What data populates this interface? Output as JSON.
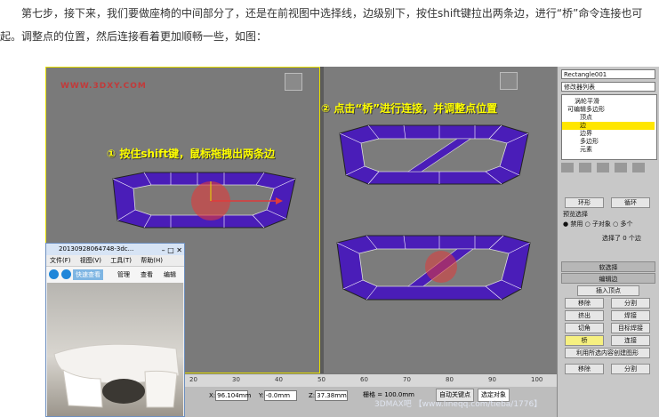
{
  "article": {
    "line1": "第七步，接下来，我们要做座椅的中间部分了，还是在前视图中选择线，边级别下，按住shift键拉出两条边，进行“桥”命令连接也可",
    "line2": "起。调整点的位置，然后连接看着更加顺畅一些，如图："
  },
  "viewport": {
    "watermark": "WWW.3DXY.COM",
    "annotation1": "按住shift键，鼠标拖拽出两条边",
    "annotation1_num": "①",
    "annotation2": "点击“桥”进行连接，并调整点位置",
    "annotation2_num": "②",
    "colors": {
      "mesh": "#4a1db8",
      "edge": "#ffffff",
      "gizmo": "#e03b3b",
      "frame": "#e7e000"
    }
  },
  "panel": {
    "object_name": "Rectangle001",
    "modifier_list": "修改器列表",
    "stack": [
      "涡轮平滑",
      "可编辑多边形",
      "顶点",
      "边",
      "边界",
      "多边形",
      "元素"
    ],
    "selected_stack_index": 3,
    "ring_label": "环形",
    "loop_label": "循环",
    "preview_label": "预览选择",
    "preview_off": "禁用",
    "preview_sub": "子对象",
    "preview_multi": "多个",
    "selected_count": "选择了 0 个边",
    "soft_select": "软选择",
    "edit_edges": "编辑边",
    "insert_vertex": "插入顶点",
    "remove": "移除",
    "split": "分割",
    "extrude": "挤出",
    "weld": "焊接",
    "chamfer": "切角",
    "target_weld": "目标焊接",
    "bridge": "桥",
    "connect": "连接",
    "create_shape": "利用所选内容创建图形",
    "bottom_remove": "移除",
    "bottom_split": "分割"
  },
  "bottombar": {
    "ticks": [
      "20",
      "30",
      "40",
      "50",
      "60",
      "70",
      "80",
      "90",
      "100"
    ],
    "x_label": "X:",
    "x_val": "96.104mm",
    "y_label": "Y:",
    "y_val": "-0.0mm",
    "z_label": "Z:",
    "z_val": "37.38mm",
    "grid": "栅格 = 100.0mm",
    "autokey": "自动关键点",
    "selected_object": "选定对象",
    "watermark": "3DMAX吧 【www.lineqq.com/tieba/1776】"
  },
  "window": {
    "title": "20130928064748-3dc...",
    "menu": [
      "文件(F)",
      "视图(V)",
      "工具(T)",
      "帮助(H)"
    ],
    "quick_view": "快速查看",
    "manage": "管理",
    "view": "查看",
    "edit": "编辑"
  }
}
